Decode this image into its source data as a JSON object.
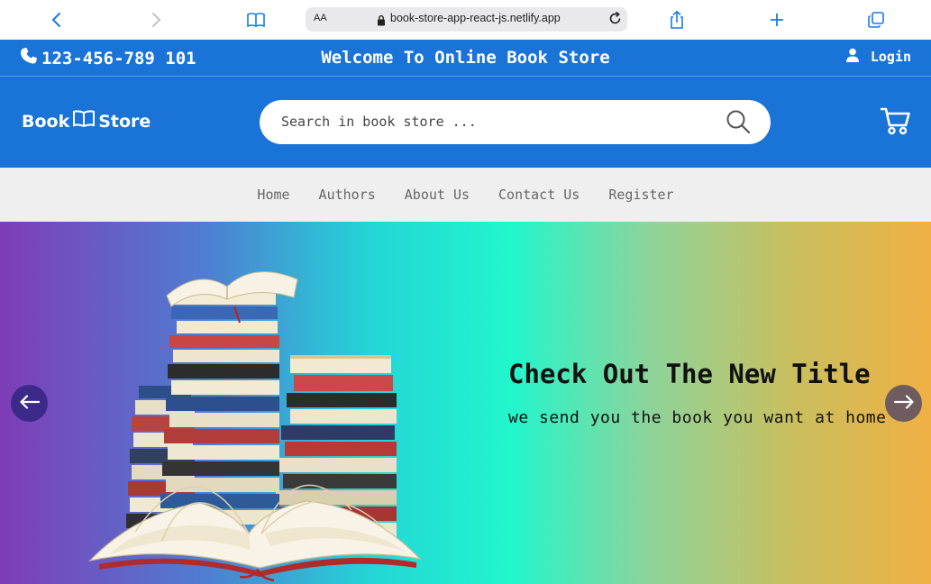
{
  "browser": {
    "text_size_label": "AA",
    "url": "book-store-app-react-js.netlify.app",
    "icons": [
      "back-icon",
      "forward-icon",
      "bookmarks-icon",
      "lock-icon",
      "reload-icon",
      "share-icon",
      "new-tab-icon",
      "tabs-icon"
    ]
  },
  "top_bar": {
    "phone": "123-456-789 101",
    "welcome": "Welcome To Online Book Store",
    "login_label": "Login"
  },
  "header": {
    "logo_left": "Book",
    "logo_right": "Store",
    "search_placeholder": "Search in book store ...",
    "search_value": ""
  },
  "nav": {
    "items": [
      {
        "label": "Home"
      },
      {
        "label": "Authors"
      },
      {
        "label": "About Us"
      },
      {
        "label": "Contact Us"
      },
      {
        "label": "Register"
      }
    ]
  },
  "hero": {
    "title": "Check Out The New Title",
    "subtitle": "we send you the book you want at home"
  },
  "colors": {
    "brand_blue": "#1a73d6",
    "nav_bg": "#efefef",
    "hero_gradient_start": "#7f3cb7",
    "hero_gradient_mid": "#22f6cc",
    "hero_gradient_end": "#f0b044"
  }
}
